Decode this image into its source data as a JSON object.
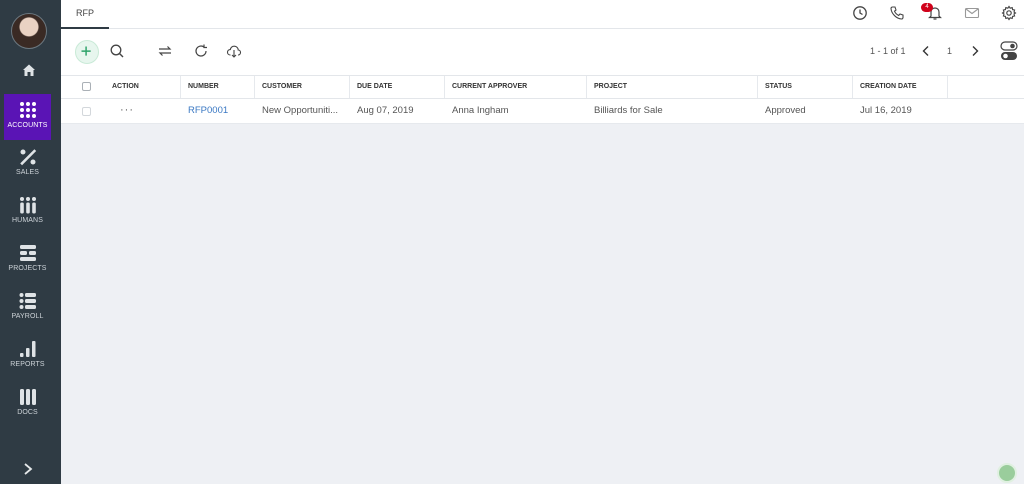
{
  "sidebar": {
    "items": [
      {
        "label": "ACCOUNTS",
        "icon": "grid-dots-icon"
      },
      {
        "label": "SALES",
        "icon": "percent-icon"
      },
      {
        "label": "HUMANS",
        "icon": "people-icon"
      },
      {
        "label": "PROJECTS",
        "icon": "projects-icon"
      },
      {
        "label": "PAYROLL",
        "icon": "list-icon"
      },
      {
        "label": "REPORTS",
        "icon": "bar-chart-icon"
      },
      {
        "label": "DOCS",
        "icon": "docs-icon"
      }
    ],
    "active_color": "#5a14b5"
  },
  "header": {
    "tab_label": "RFP",
    "notification_count": "4"
  },
  "toolbar": {
    "pager_range": "1 - 1 of 1",
    "page_number": "1"
  },
  "table": {
    "columns": [
      "ACTION",
      "NUMBER",
      "CUSTOMER",
      "DUE DATE",
      "CURRENT APPROVER",
      "PROJECT",
      "STATUS",
      "CREATION DATE"
    ],
    "rows": [
      {
        "action": "···",
        "number": "RFP0001",
        "customer": "New Opportuniti...",
        "due_date": "Aug 07, 2019",
        "approver": "Anna Ingham",
        "project": "Billiards for Sale",
        "status": "Approved",
        "creation_date": "Jul 16, 2019"
      }
    ]
  }
}
